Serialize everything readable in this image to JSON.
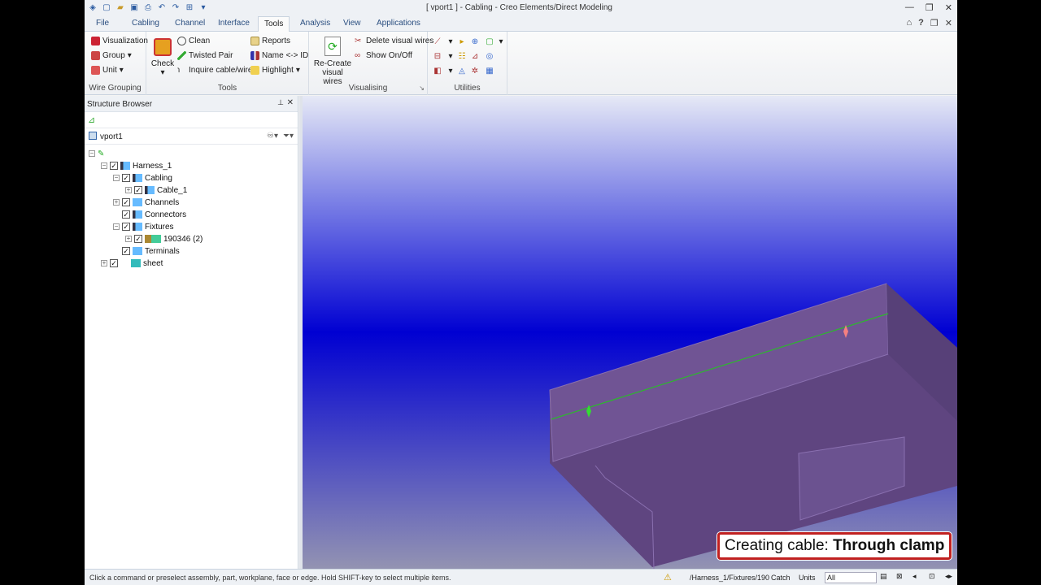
{
  "window": {
    "title": "[ vport1 ] - Cabling - Creo Elements/Direct Modeling"
  },
  "tabs": [
    {
      "label": "File"
    },
    {
      "label": "Cabling"
    },
    {
      "label": "Channel"
    },
    {
      "label": "Interface"
    },
    {
      "label": "Tools"
    },
    {
      "label": "Analysis"
    },
    {
      "label": "View"
    },
    {
      "label": "Applications"
    }
  ],
  "ribbon": {
    "wire_grouping": {
      "label": "Wire Grouping",
      "visualization": "Visualization",
      "group": "Group",
      "unit": "Unit"
    },
    "tools": {
      "label": "Tools",
      "check": "Check",
      "clean": "Clean",
      "twisted_pair": "Twisted Pair",
      "inquire": "Inquire cable/wire",
      "reports": "Reports",
      "name_id": "Name <-> ID",
      "highlight": "Highlight"
    },
    "visualising": {
      "label": "Visualising",
      "recreate_l1": "Re-Create",
      "recreate_l2": "visual wires",
      "delete": "Delete visual wires",
      "show": "Show On/Off"
    },
    "utilities": {
      "label": "Utilities"
    }
  },
  "browser": {
    "title": "Structure Browser",
    "viewport": "vport1",
    "tree": [
      {
        "label": "Harness_1"
      },
      {
        "label": "Cabling"
      },
      {
        "label": "Cable_1"
      },
      {
        "label": "Channels"
      },
      {
        "label": "Connectors"
      },
      {
        "label": "Fixtures"
      },
      {
        "label": "190346 (2)"
      },
      {
        "label": "Terminals"
      },
      {
        "label": "sheet"
      }
    ]
  },
  "caption": {
    "prefix": "Creating cable: ",
    "strong": "Through clamp"
  },
  "status": {
    "message": "Click a command or preselect assembly, part, workplane, face or edge. Hold SHIFT-key to select multiple items.",
    "path": "/Harness_1/Fixtures/190",
    "catch": "Catch",
    "units": "Units",
    "filter": "All"
  },
  "colors": {
    "ribbon_bg": "#fbfbfb",
    "accent_text": "#2b4f80",
    "caption_border": "#c02020",
    "part_face": "#6a4c88"
  }
}
